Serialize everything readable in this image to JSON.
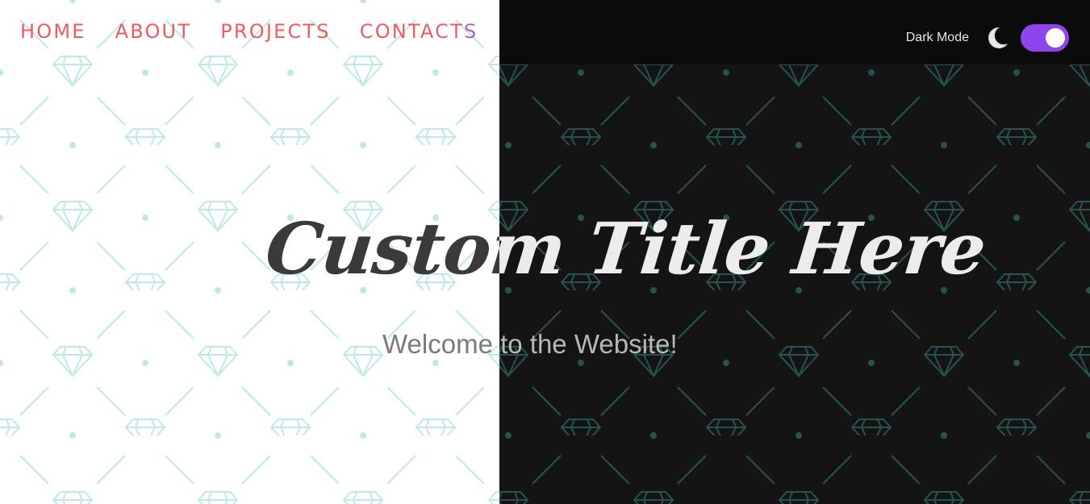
{
  "nav": {
    "items": [
      {
        "label": "HOME"
      },
      {
        "label": "ABOUT"
      },
      {
        "label": "PROJECTS"
      },
      {
        "label": "CONTACTS"
      }
    ]
  },
  "mode_toggle": {
    "label": "Dark Mode",
    "icon": "moon-icon",
    "state": "on"
  },
  "hero": {
    "title": "Custom Title Here",
    "subtitle": "Welcome to the Website!"
  },
  "colors": {
    "nav_link": "#ef5a63",
    "toggle_accent": "#8f45ee",
    "light_background": "#ffffff",
    "dark_background": "#141414",
    "pattern_light": "#bfeae4",
    "pattern_dark": "#28524d"
  }
}
